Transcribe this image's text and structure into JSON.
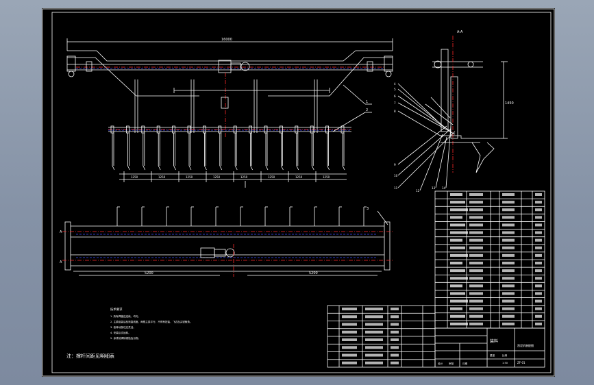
{
  "viewport": {
    "background_color": "#8d99ac"
  },
  "drawing": {
    "background_color": "#000000",
    "line_color": "#ffffff",
    "centerline_color": "#ff2a2a",
    "hidden_line_color": "#3a4cff",
    "section_label": "A-A",
    "overall_dimension": "16000",
    "leader_numbers": [
      "1",
      "2",
      "3",
      "4",
      "5",
      "6",
      "7",
      "8",
      "9",
      "10",
      "11",
      "12",
      "13",
      "14"
    ],
    "dimensions": {
      "lower_spacing": [
        "1250",
        "1250",
        "1250",
        "1250",
        "1250",
        "1250",
        "1250",
        "1250"
      ],
      "plan_spans": [
        "5200",
        "5200"
      ],
      "section_height": "1450"
    },
    "notes_title": "技术要求",
    "notes": [
      "1. 所有焊缝应连续、均匀。",
      "2. 主梁组装后检测直线度，两根主梁平行，不得有扭曲、飞边及尖锐棱角。",
      "3. 各转动部位应灵活。",
      "4. 安装后试运转。",
      "5. 涂漆前清除锈蚀及污物。"
    ],
    "footnote": "注：撑杆间距见明细表",
    "title_block": {
      "name": "装料",
      "drawing_no": "刮泥机装配图",
      "scale": "1:50",
      "sheet_code": "ZF-01",
      "weight_label": "重量",
      "scale_label": "比例",
      "sign_labels": [
        "设计",
        "审核",
        "日期"
      ]
    },
    "bom_rows": 18,
    "lower_bom_rows": 8
  }
}
